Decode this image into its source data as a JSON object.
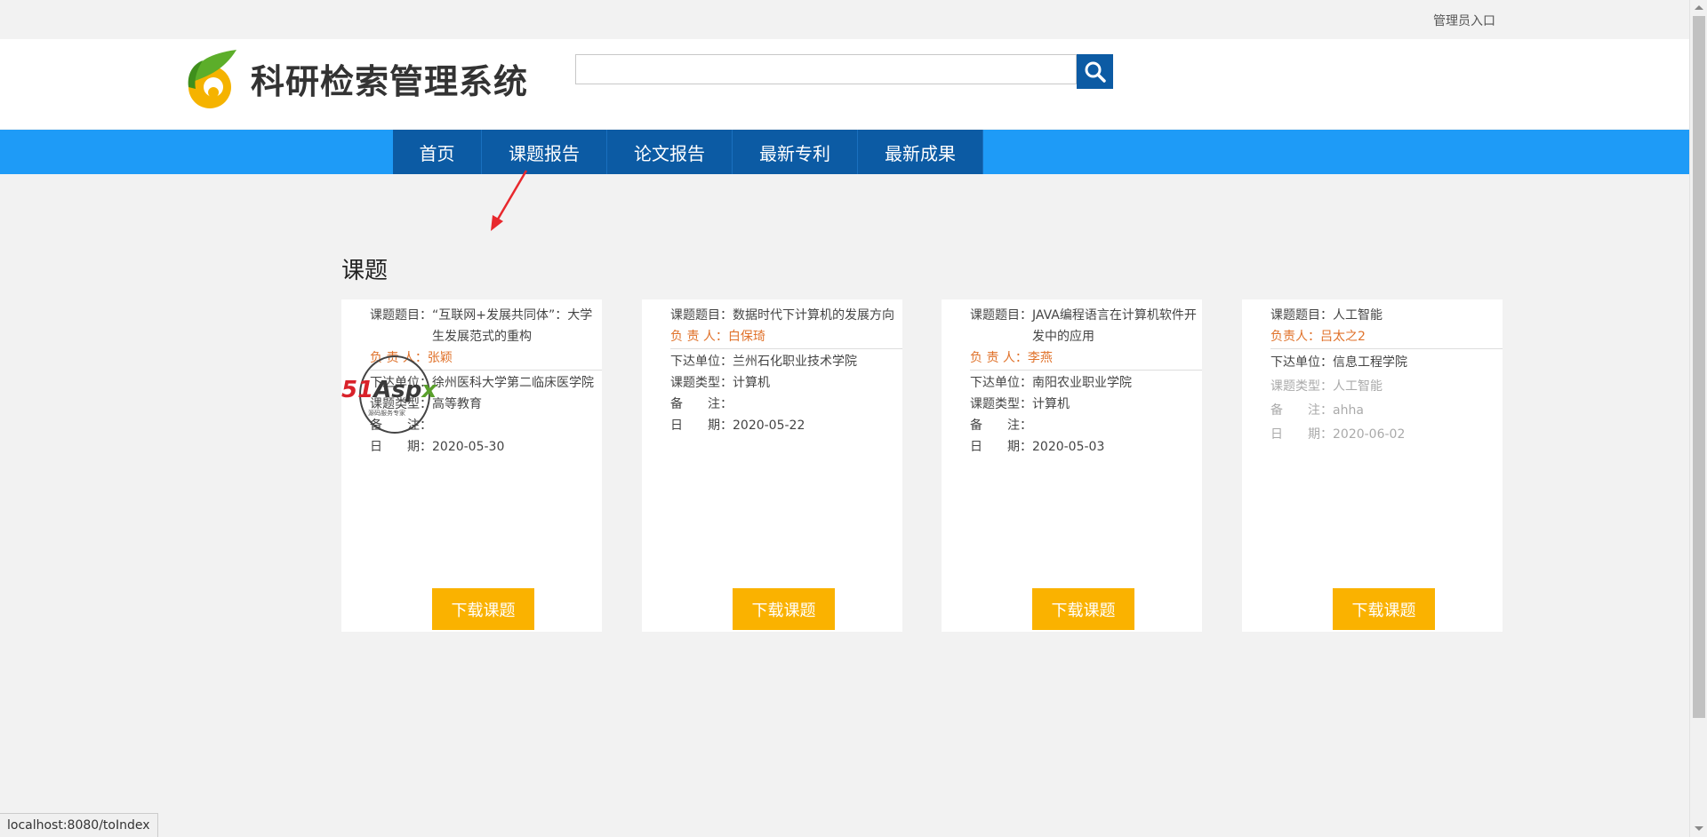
{
  "topbar": {
    "admin_link": "管理员入口"
  },
  "header": {
    "logo_text": "科研检索管理系统",
    "search_placeholder": ""
  },
  "nav": {
    "items": [
      "首页",
      "课题报告",
      "论文报告",
      "最新专利",
      "最新成果"
    ]
  },
  "section": {
    "title": "课题"
  },
  "labels": {
    "topic": "课题题目：",
    "owner": "负 责 人：",
    "owner_alt": "负责人：",
    "unit": "下达单位：",
    "type": "课题类型：",
    "note": "备　　注：",
    "date": "日　　期：",
    "download": "下载课题"
  },
  "cards": [
    {
      "topic": "“互联网+发展共同体”：大学生发展范式的重构",
      "owner": "张颖",
      "unit": "徐州医科大学第二临床医学院",
      "type": "高等教育",
      "note": "",
      "date": "2020-05-30"
    },
    {
      "topic": "数据时代下计算机的发展方向",
      "owner": "白保琦",
      "unit": "兰州石化职业技术学院",
      "type": "计算机",
      "note": "",
      "date": "2020-05-22"
    },
    {
      "topic": "JAVA编程语言在计算机软件开发中的应用",
      "owner": "李燕",
      "unit": "南阳农业职业学院",
      "type": "计算机",
      "note": "",
      "date": "2020-05-03"
    },
    {
      "topic": "人工智能",
      "owner": "吕太之2",
      "unit": "信息工程学院",
      "type": "人工智能",
      "note": "ahha",
      "date": "2020-06-02"
    }
  ],
  "watermark": {
    "brand_51": "51",
    "brand_asp": "Asp",
    "brand_x": "x",
    "sub": "源码服务专家"
  },
  "statusbar": {
    "url": "localhost:8080/toIndex"
  },
  "colors": {
    "nav_bg": "#1e9bf7",
    "nav_item": "#0c5ba4",
    "accent_button": "#fab200",
    "owner_text": "#e0722b"
  }
}
